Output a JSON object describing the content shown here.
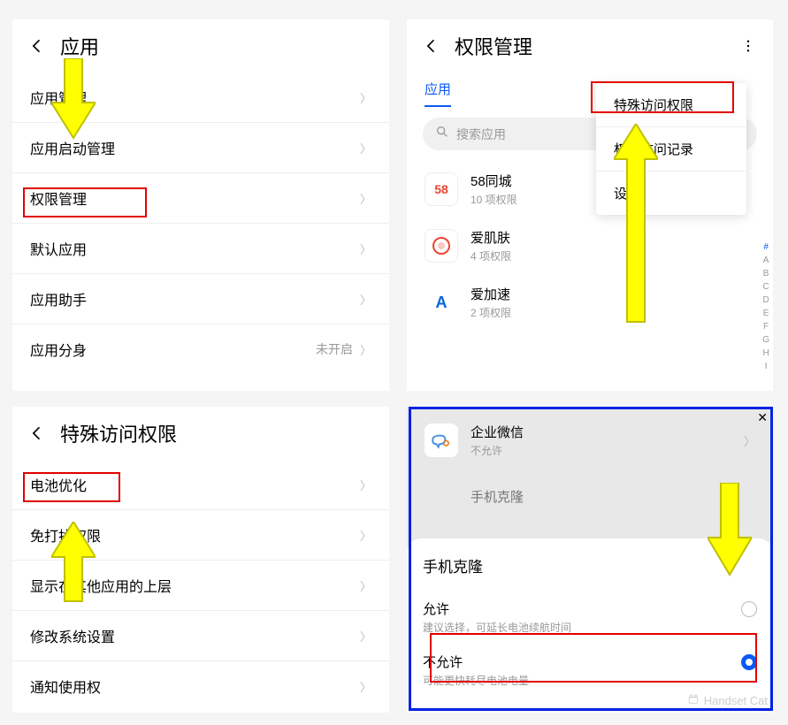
{
  "p1": {
    "title": "应用",
    "items": [
      {
        "label": "应用管理"
      },
      {
        "label": "应用启动管理"
      },
      {
        "label": "权限管理"
      },
      {
        "label": "默认应用"
      },
      {
        "label": "应用助手"
      },
      {
        "label": "应用分身",
        "value": "未开启"
      }
    ]
  },
  "p2": {
    "title": "特殊访问权限",
    "items": [
      {
        "label": "电池优化"
      },
      {
        "label": "免打扰权限"
      },
      {
        "label": "显示在其他应用的上层"
      },
      {
        "label": "修改系统设置"
      },
      {
        "label": "通知使用权"
      }
    ]
  },
  "p3": {
    "title": "权限管理",
    "tab_active": "应用",
    "popup": [
      "特殊访问权限",
      "权限访问记录",
      "设置"
    ],
    "search_placeholder": "搜索应用",
    "apps": [
      {
        "name": "58同城",
        "detail": "10 项权限"
      },
      {
        "name": "爱肌肤",
        "detail": "4 项权限"
      },
      {
        "name": "爱加速",
        "detail": "2 项权限"
      }
    ],
    "index": [
      "#",
      "A",
      "B",
      "C",
      "D",
      "E",
      "F",
      "G",
      "H",
      "I"
    ]
  },
  "p4": {
    "apps": [
      {
        "name": "企业微信",
        "detail": "不允许"
      },
      {
        "name": "手机克隆",
        "detail": ""
      }
    ],
    "sheet_title": "手机克隆",
    "opt1_label": "允许",
    "opt1_sub": "建议选择，可延长电池续航时间",
    "opt2_label": "不允许",
    "opt2_sub": "可能更快耗尽电池电量",
    "watermark": "Handset Cat"
  }
}
